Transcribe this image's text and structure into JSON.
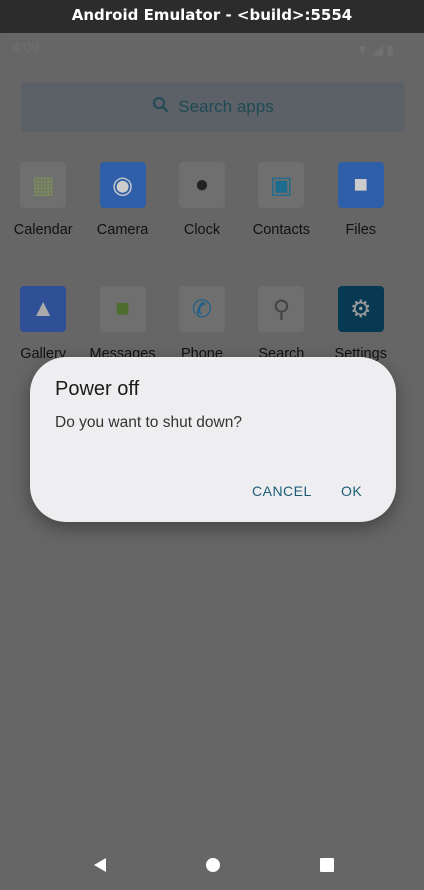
{
  "window": {
    "title": "Android Emulator - <build>:5554"
  },
  "status_bar": {
    "time": "4:09"
  },
  "search": {
    "label": "Search apps"
  },
  "apps_row1": [
    {
      "label": "Calendar",
      "icon": "calendar-icon",
      "color": "#7a8a5a"
    },
    {
      "label": "Camera",
      "icon": "camera-icon",
      "color": "#2f5fa8"
    },
    {
      "label": "Clock",
      "icon": "clock-icon",
      "color": "#222222"
    },
    {
      "label": "Contacts",
      "icon": "contacts-icon",
      "color": "#1b6c8f"
    },
    {
      "label": "Files",
      "icon": "folder-icon",
      "color": "#2f5fa8"
    }
  ],
  "apps_row2": [
    {
      "label": "Gallery",
      "icon": "gallery-icon",
      "color": "#2f5096"
    },
    {
      "label": "Messages",
      "icon": "messages-icon",
      "color": "#4d6e2e"
    },
    {
      "label": "Phone",
      "icon": "phone-icon",
      "color": "#1b5f8a"
    },
    {
      "label": "Search",
      "icon": "magnifier-icon",
      "color": "#6a6a6a"
    },
    {
      "label": "Settings",
      "icon": "gear-icon",
      "color": "#073a52"
    }
  ],
  "dialog": {
    "title": "Power off",
    "message": "Do you want to shut down?",
    "cancel": "CANCEL",
    "ok": "OK"
  }
}
